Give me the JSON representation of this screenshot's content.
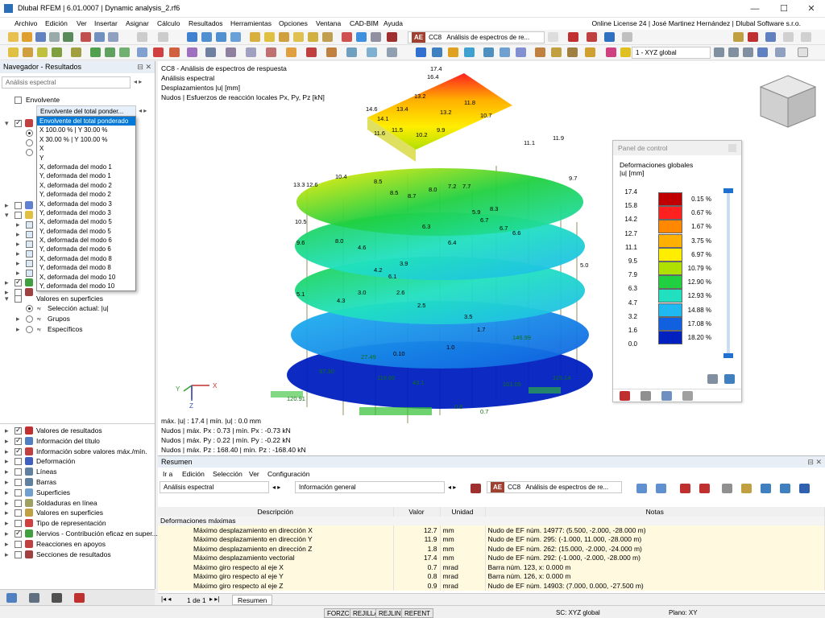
{
  "window": {
    "title": "Dlubal RFEM | 6.01.0007 | Dynamic analysis_2.rf6",
    "controls": [
      "—",
      "☐",
      "✕"
    ]
  },
  "menu": {
    "items": [
      "Archivo",
      "Edición",
      "Ver",
      "Insertar",
      "Asignar",
      "Cálculo",
      "Resultados",
      "Herramientas",
      "Opciones",
      "Ventana",
      "CAD-BIM",
      "Ayuda"
    ],
    "license": "Online License 24 | José Martinez Hernández | Dlubal Software s.r.o."
  },
  "toolbar": {
    "ae": "AE",
    "case_code": "CC8",
    "case_name": "Análisis de espectros de re...",
    "view": "1 - XYZ global"
  },
  "navigator": {
    "title": "Navegador - Resultados",
    "analysis": "Análisis espectral",
    "envelope_label": "Envolvente",
    "envelope_value": "Envolvente del total ponder...",
    "dropdown_items": [
      "Envolvente del total ponderado",
      "X 100.00 % | Y 30.00 %",
      "X 30.00 % | Y 100.00 %",
      "X",
      "Y",
      "X, deformada del modo 1",
      "Y, deformada del modo 1",
      "X, deformada del modo 2",
      "Y, deformada del modo 2",
      "X, deformada del modo 3",
      "Y, deformada del modo 3",
      "X, deformada del modo 5",
      "Y, deformada del modo 5",
      "X, deformada del modo 6",
      "Y, deformada del modo 6",
      "X, deformada del modo 8",
      "Y, deformada del modo 8",
      "X, deformada del modo 10",
      "Y, deformada del modo 10"
    ],
    "surfaces": {
      "label": "Valores en superficies",
      "current": "Selección actual: |u|",
      "groups": "Grupos",
      "specific": "Específicos"
    },
    "display_items": [
      "Valores de resultados",
      "Información del título",
      "Información sobre valores máx./mín.",
      "Deformación",
      "Líneas",
      "Barras",
      "Superficies",
      "Soldaduras en línea",
      "Valores en superficies",
      "Tipo de representación",
      "Nervios - Contribución eficaz en super...",
      "Reacciones en apoyos",
      "Secciones de resultados"
    ]
  },
  "viewport": {
    "header": [
      "CC8 - Análisis de espectros de respuesta",
      "Análisis espectral",
      "Desplazamientos |u| [mm]",
      "Nudos | Esfuerzos de reacción locales Px, Py, Pz [kN]"
    ],
    "footer": [
      "máx. |u| : 17.4 | mín. |u| : 0.0 mm",
      "Nudos | máx. Px : 0.73 | mín. Px : -0.73 kN",
      "Nudos | máx. Py : 0.22 | mín. Py : -0.22 kN",
      "Nudos | máx. Pz : 168.40 | mín. Pz : -168.40 kN"
    ],
    "axes": {
      "x": "X",
      "y": "Y",
      "z": "Z"
    },
    "labels_top": [
      "17.4",
      "16.4",
      "14.6",
      "14.1",
      "13.4",
      "11.8",
      "13.2",
      "10.7",
      "13.2",
      "11.5",
      "11.6",
      "10.2",
      "9.9",
      "11.9",
      "11.1",
      "10.4",
      "8.5",
      "9.7",
      "13.3",
      "12.6",
      "8.5",
      "8.7",
      "8.0",
      "7.2",
      "7.7",
      "8.3",
      "6.7",
      "5.9",
      "6.3",
      "6.4",
      "6.7",
      "6.6",
      "10.5",
      "9.6",
      "8.0",
      "4.6",
      "3.9",
      "4.2",
      "5.0",
      "6.1",
      "5.1",
      "4.3",
      "3.0",
      "2.5",
      "2.6",
      "3.5",
      "1.7",
      "1.0",
      "0.10",
      "27.49",
      "97.30",
      "119.60",
      "43.1",
      "101.05",
      "115.14",
      "120.91",
      "146.99",
      "0.8",
      "0.7"
    ]
  },
  "control_panel": {
    "title": "Panel de control",
    "subtitle": "Deformaciones globales",
    "unit": "|u| [mm]",
    "values": [
      "17.4",
      "15.8",
      "14.2",
      "12.7",
      "11.1",
      "9.5",
      "7.9",
      "6.3",
      "4.7",
      "3.2",
      "1.6",
      "0.0"
    ],
    "colors": [
      "#c00000",
      "#ff2020",
      "#ff8800",
      "#ffb000",
      "#ffee00",
      "#b0e000",
      "#20d040",
      "#20e0c0",
      "#20b8f0",
      "#1060e0",
      "#0020c0",
      "#001088"
    ],
    "percents": [
      "0.15 %",
      "0.67 %",
      "1.67 %",
      "3.75 %",
      "6.97 %",
      "10.79 %",
      "12.90 %",
      "12.93 %",
      "14.88 %",
      "17.08 %",
      "18.20 %"
    ]
  },
  "summary": {
    "title": "Resumen",
    "menu": [
      "Ir a",
      "Edición",
      "Selección",
      "Ver",
      "Configuración"
    ],
    "analysis": "Análisis espectral",
    "info": "Información general",
    "ae": "AE",
    "case_code": "CC8",
    "case_name": "Análisis de espectros de re...",
    "columns": [
      "Descripción",
      "Valor",
      "Unidad",
      "Notas"
    ],
    "group": "Deformaciones máximas",
    "rows": [
      [
        "Máximo desplazamiento en dirección X",
        "12.7",
        "mm",
        "Nudo de EF núm. 14977: (5.500, -2.000, -28.000 m)"
      ],
      [
        "Máximo desplazamiento en dirección Y",
        "11.9",
        "mm",
        "Nudo de EF núm. 295: (-1.000, 11.000, -28.000 m)"
      ],
      [
        "Máximo desplazamiento en dirección Z",
        "1.8",
        "mm",
        "Nudo de EF núm. 262: (15.000, -2.000, -24.000 m)"
      ],
      [
        "Máximo desplazamiento vectorial",
        "17.4",
        "mm",
        "Nudo de EF núm. 292: (-1.000, -2.000, -28.000 m)"
      ],
      [
        "Máximo giro respecto al eje X",
        "0.7",
        "mrad",
        "Barra núm. 123, x: 0.000 m"
      ],
      [
        "Máximo giro respecto al eje Y",
        "0.8",
        "mrad",
        "Barra núm. 126, x: 0.000 m"
      ],
      [
        "Máximo giro respecto al eje Z",
        "0.9",
        "mrad",
        "Nudo de EF núm. 14903: (7.000, 0.000, -27.500 m)"
      ]
    ],
    "pager": "1 de 1",
    "tab": "Resumen"
  },
  "status": {
    "buttons": [
      "FORZC",
      "REJILLA",
      "REJLIN",
      "REFENT"
    ],
    "cs": "SC: XYZ global",
    "plane": "Plano: XY"
  }
}
